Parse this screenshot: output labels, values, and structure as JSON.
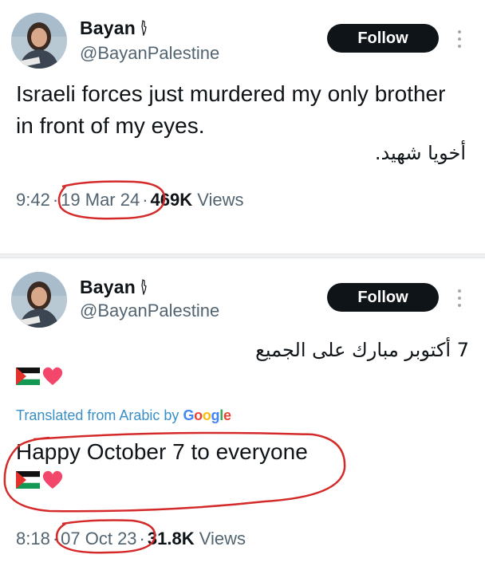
{
  "tweets": [
    {
      "author_name": "Bayan",
      "handle": "@BayanPalestine",
      "follow_label": "Follow",
      "text": "Israeli forces just murdered my only brother in front of my eyes.",
      "arabic_text": "أخويا شهيد.",
      "time": "9:42",
      "date": "19 Mar 24",
      "views_count": "469K",
      "views_label": "Views",
      "separator": "·"
    },
    {
      "author_name": "Bayan",
      "handle": "@BayanPalestine",
      "follow_label": "Follow",
      "arabic_text": "7 أكتوبر مبارك على الجميع",
      "translated_prefix": "Translated from Arabic by",
      "translated_brand": "Google",
      "translated_text": "Happy October 7 to everyone",
      "time": "8:18",
      "date": "07 Oct 23",
      "views_count": "31.8K",
      "views_label": "Views",
      "separator": "·"
    }
  ],
  "icons": {
    "more": "more-vertical-icon",
    "palestine_flag": "palestine-flag-icon",
    "heart": "heart-icon"
  },
  "colors": {
    "follow_bg": "#0f1419",
    "secondary_text": "#536471",
    "translated_link": "#3a8fc7",
    "annotation_red": "#d42a2a"
  }
}
